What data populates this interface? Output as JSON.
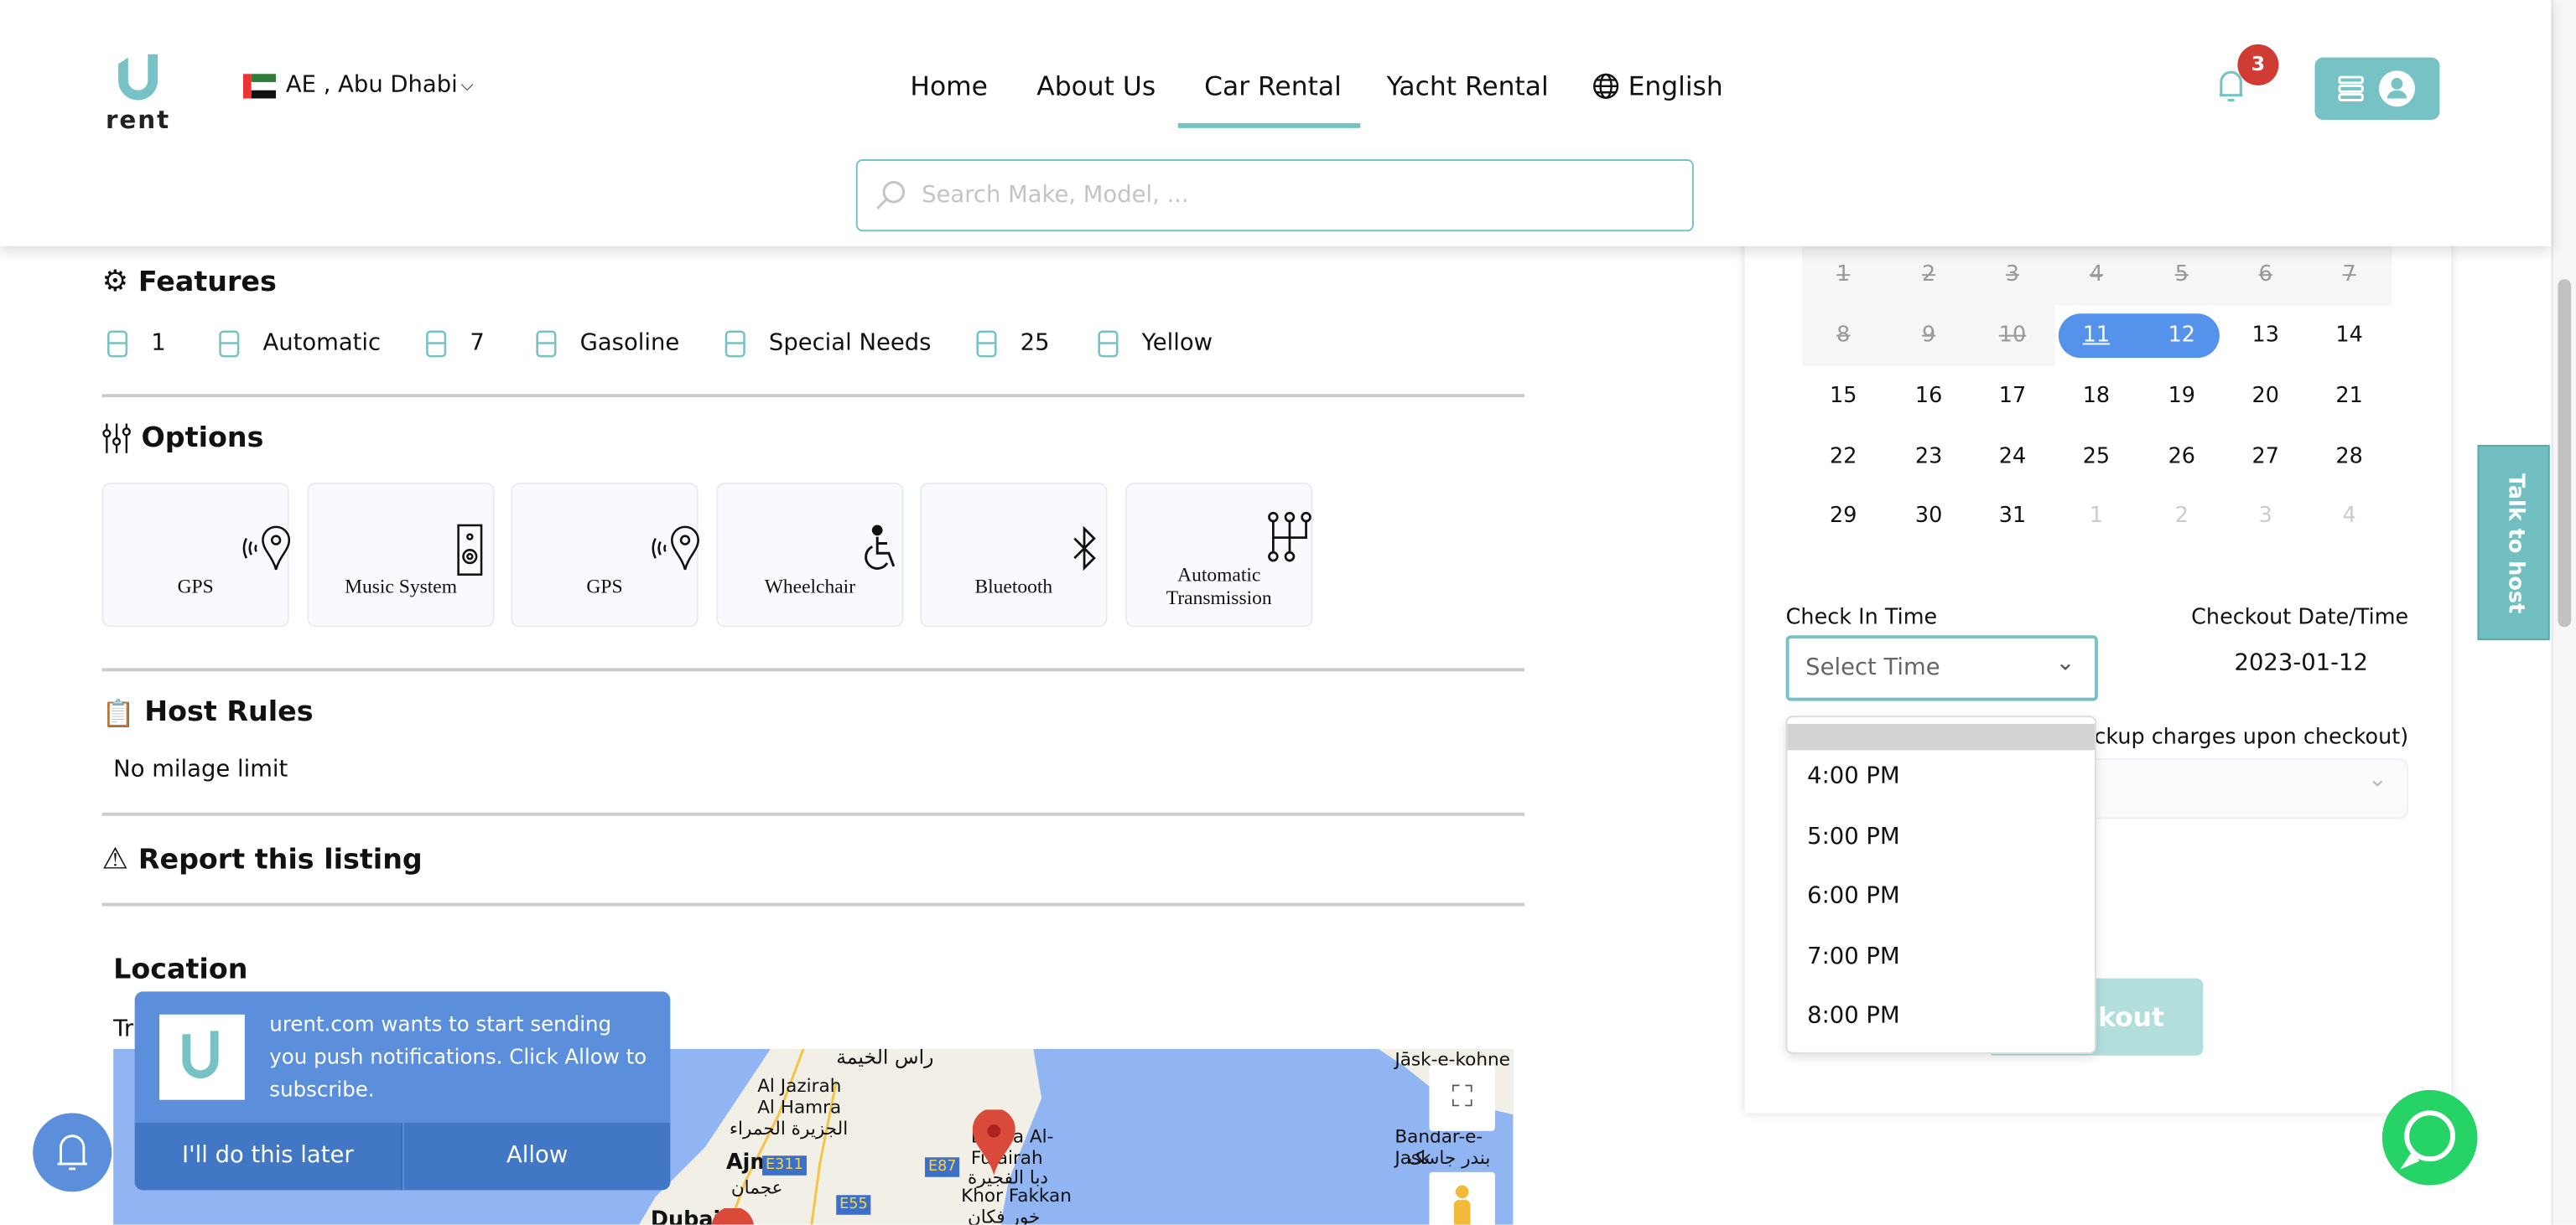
{
  "header": {
    "logo_text": "rent",
    "location": "AE , Abu Dhabi",
    "nav": [
      "Home",
      "About Us",
      "Car Rental",
      "Yacht Rental"
    ],
    "active_nav": "Car Rental",
    "language": "English",
    "search_placeholder": "Search Make, Model, ...",
    "notification_count": "3",
    "accent_color": "#76c2c5"
  },
  "features": {
    "title": "Features",
    "items": [
      {
        "icon": "door-icon",
        "value": "1"
      },
      {
        "icon": "gearshift-icon",
        "value": "Automatic"
      },
      {
        "icon": "seat-icon",
        "value": "7"
      },
      {
        "icon": "fuel-pump-icon",
        "value": "Gasoline"
      },
      {
        "icon": "car-icon",
        "value": "Special Needs"
      },
      {
        "icon": "seat-icon",
        "value": "25"
      },
      {
        "icon": "palette-icon",
        "value": "Yellow"
      }
    ]
  },
  "options": {
    "title": "Options",
    "items": [
      {
        "icon": "gps-icon",
        "label": "GPS"
      },
      {
        "icon": "speaker-icon",
        "label": "Music System"
      },
      {
        "icon": "gps-icon",
        "label": "GPS"
      },
      {
        "icon": "wheelchair-icon",
        "label": "Wheelchair"
      },
      {
        "icon": "bluetooth-icon",
        "label": "Bluetooth"
      },
      {
        "icon": "gearshift-icon",
        "label": "Automatic Transmission"
      }
    ]
  },
  "host_rules": {
    "title": "Host Rules",
    "text": "No milage limit"
  },
  "report": {
    "title": "Report this listing"
  },
  "location": {
    "title": "Location",
    "subtitle_partial": "Tr",
    "map_labels": [
      "رأس الخيمة",
      "Al Jazirah Al Hamra",
      "الجزيرة الحمراء",
      "Ajman",
      "عجمان",
      "Dibba Al-Fujairah",
      "دبا الفجيرة",
      "Khor Fakkan",
      "خور فكان",
      "Jāsk-e-kohne",
      "Bandar-e-Jask",
      "بندر جاسک",
      "Dubai",
      "E311",
      "E87",
      "E55"
    ]
  },
  "calendar": {
    "rows": [
      [
        {
          "d": "1",
          "s": "past"
        },
        {
          "d": "2",
          "s": "past"
        },
        {
          "d": "3",
          "s": "past"
        },
        {
          "d": "4",
          "s": "past"
        },
        {
          "d": "5",
          "s": "past"
        },
        {
          "d": "6",
          "s": "past"
        },
        {
          "d": "7",
          "s": "past"
        }
      ],
      [
        {
          "d": "8",
          "s": "past"
        },
        {
          "d": "9",
          "s": "past"
        },
        {
          "d": "10",
          "s": "past"
        },
        {
          "d": "11",
          "s": "sel"
        },
        {
          "d": "12",
          "s": "sel"
        },
        {
          "d": "13",
          "s": ""
        },
        {
          "d": "14",
          "s": ""
        }
      ],
      [
        {
          "d": "15",
          "s": ""
        },
        {
          "d": "16",
          "s": ""
        },
        {
          "d": "17",
          "s": ""
        },
        {
          "d": "18",
          "s": ""
        },
        {
          "d": "19",
          "s": ""
        },
        {
          "d": "20",
          "s": ""
        },
        {
          "d": "21",
          "s": ""
        }
      ],
      [
        {
          "d": "22",
          "s": ""
        },
        {
          "d": "23",
          "s": ""
        },
        {
          "d": "24",
          "s": ""
        },
        {
          "d": "25",
          "s": ""
        },
        {
          "d": "26",
          "s": ""
        },
        {
          "d": "27",
          "s": ""
        },
        {
          "d": "28",
          "s": ""
        }
      ],
      [
        {
          "d": "29",
          "s": ""
        },
        {
          "d": "30",
          "s": ""
        },
        {
          "d": "31",
          "s": ""
        },
        {
          "d": "1",
          "s": "next"
        },
        {
          "d": "2",
          "s": "next"
        },
        {
          "d": "3",
          "s": "next"
        },
        {
          "d": "4",
          "s": "next"
        }
      ]
    ],
    "selected_color": "#5592ec"
  },
  "booking": {
    "checkin_label": "Check In Time",
    "checkin_placeholder": "Select Time",
    "checkout_label": "Checkout Date/Time",
    "checkout_date": "2023-01-12",
    "pickup_label_partial": "ickup charges upon checkout)",
    "time_options": [
      "4:00 PM",
      "5:00 PM",
      "6:00 PM",
      "7:00 PM",
      "8:00 PM"
    ],
    "checkout_button": "Checkout"
  },
  "talk_to_host": "Talk to host",
  "push_prompt": {
    "message": "urent.com wants to start sending you push notifications. Click Allow to subscribe.",
    "later": "I'll do this later",
    "allow": "Allow"
  }
}
